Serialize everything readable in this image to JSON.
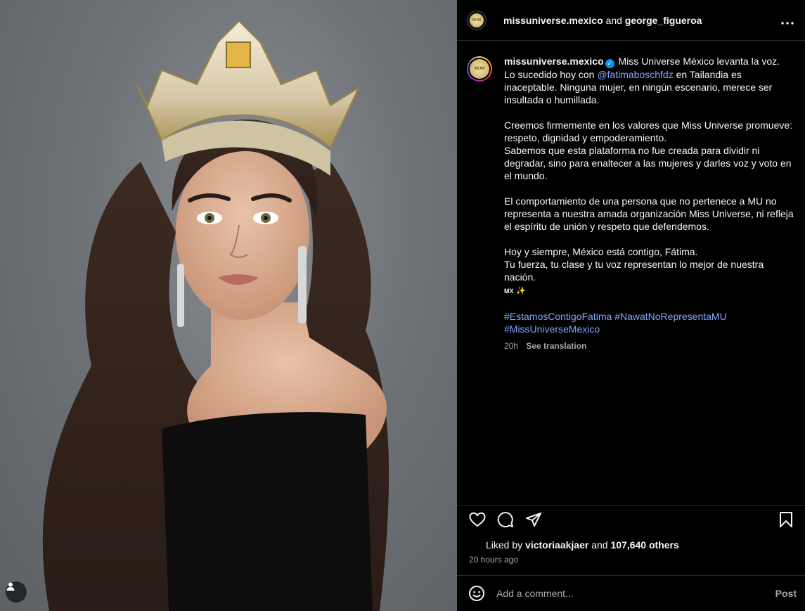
{
  "post": {
    "header": {
      "author": "missuniverse.mexico",
      "conjunction": "and",
      "coauthor": "george_figueroa",
      "more_icon": "more-horizontal-icon"
    },
    "caption": {
      "username": "missuniverse.mexico",
      "verified_icon": "verified-badge-icon",
      "line1": "Miss Universe México levanta la voz.",
      "line2_pre": "Lo sucedido hoy con ",
      "mention": "@fatimaboschfdz",
      "line2_post": " en Tailandia es inaceptable. Ninguna mujer, en ningún escenario, merece ser insultada o humillada.",
      "para2": "Creemos firmemente en los valores que Miss Universe promueve: respeto, dignidad y empoderamiento.",
      "para2b": "Sabemos que esta plataforma no fue creada para dividir ni degradar, sino para enaltecer a las mujeres y darles voz y voto en el mundo.",
      "para3": "El comportamiento de una persona que no pertenece a MU no representa a nuestra amada organización Miss Universe, ni refleja el espíritu de unión y respeto que defendemos.",
      "para4a": "Hoy y siempre, México está contigo, Fátima.",
      "para4b": "Tu fuerza, tu clase y tu voz representan lo mejor de nuestra nación.",
      "flag": "MX",
      "sparkle": "✨",
      "hashtags": [
        "#EstamosContigoFatima",
        "#NawatNoRepresentaMU",
        "#MissUniverseMexico"
      ],
      "age": "20h",
      "see_translation": "See translation"
    },
    "actions": {
      "like_icon": "heart-icon",
      "comment_icon": "comment-bubble-icon",
      "share_icon": "send-paper-plane-icon",
      "save_icon": "bookmark-icon"
    },
    "likes": {
      "prefix": "Liked by",
      "user": "victoriaakjaer",
      "and": "and",
      "others": "107,640 others"
    },
    "timestamp": "20 hours ago",
    "comment": {
      "emoji_icon": "smiley-emoji-icon",
      "placeholder": "Add a comment...",
      "post_label": "Post"
    },
    "tag_icon": "user-tag-icon",
    "avatar_text": "MUM"
  }
}
